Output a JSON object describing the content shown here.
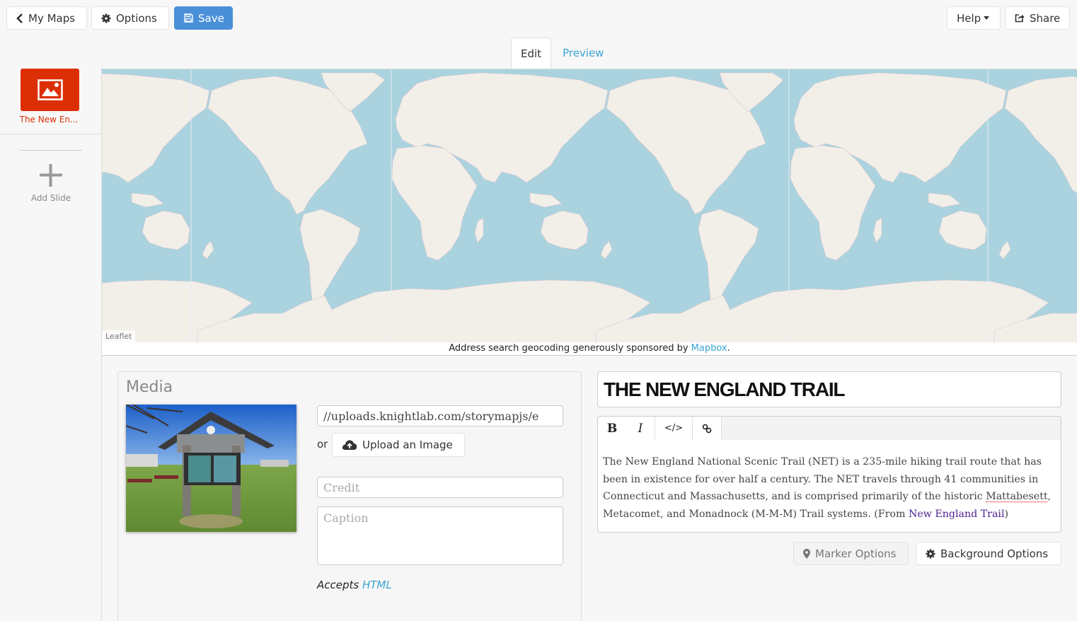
{
  "toolbar": {
    "my_maps": "My Maps",
    "options": "Options",
    "save": "Save",
    "help": "Help",
    "share": "Share"
  },
  "tabs": [
    {
      "label": "Edit",
      "active": true
    },
    {
      "label": "Preview",
      "active": false
    }
  ],
  "sidebar": {
    "slides": [
      {
        "label": "The New En...",
        "icon": "image-icon",
        "selected": true
      }
    ],
    "add_slide": "Add Slide"
  },
  "map": {
    "attribution": "Leaflet",
    "geocode_note_prefix": "Address search geocoding generously sponsored by ",
    "geocode_link": "Mapbox",
    "geocode_note_suffix": "."
  },
  "media": {
    "title": "Media",
    "url_value": "//uploads.knightlab.com/storymapjs/e",
    "or_label": "or",
    "upload_button": "Upload an Image",
    "credit_placeholder": "Credit",
    "caption_placeholder": "Caption",
    "accepts_label": "Accepts",
    "accepts_link": "HTML",
    "image_alt": "New England Trail Southern Gateway sign"
  },
  "slide": {
    "headline": "THE NEW ENGLAND TRAIL",
    "editor_buttons": [
      "B",
      "I",
      "</>",
      "link-icon"
    ],
    "text_1": "The New England National Scenic Trail (NET) is a 235-mile hiking trail route that has been in existence for over half a century. The NET travels through 41 communities in Connecticut and Massachusetts, and is comprised primarily of the historic ",
    "text_spell": "Mattabesett",
    "text_2": ", Metacomet, and Monadnock (M-M-M) Trail systems. (From ",
    "text_link": "New England Trail",
    "text_3": ")"
  },
  "options": {
    "marker": "Marker Options",
    "background": "Background Options"
  },
  "colors": {
    "primary": "#4a90d9",
    "accent_red": "#dd2f05",
    "link_blue": "#3aa5d3",
    "water": "#aad3df",
    "land": "#f2efe9"
  }
}
